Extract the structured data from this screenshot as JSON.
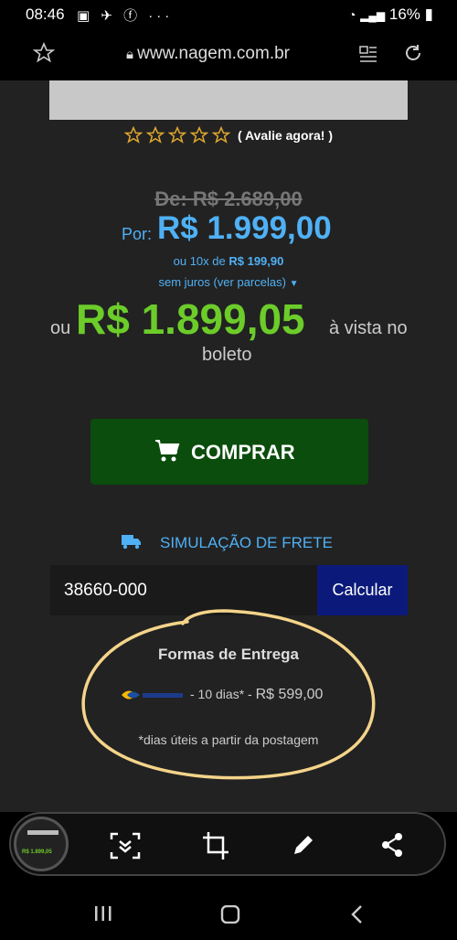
{
  "status_bar": {
    "time": "08:46",
    "battery": "16%"
  },
  "browser": {
    "url": "www.nagem.com.br"
  },
  "rating": {
    "label": "( Avalie agora! )"
  },
  "price": {
    "old": "De: R$ 2.689,00",
    "por_label": "Por:",
    "current": "R$ 1.999,00",
    "installments_prefix": "ou 10x de",
    "installments_value": "R$ 199,90",
    "installments_note": "sem juros (ver parcelas)",
    "ou": "ou",
    "boleto_price": "R$ 1.899,05",
    "boleto_suffix": "à vista no",
    "boleto_word": "boleto"
  },
  "buy_button": {
    "label": "COMPRAR"
  },
  "shipping": {
    "title": "SIMULAÇÃO DE FRETE",
    "cep_value": "38660-000",
    "calc_label": "Calcular",
    "delivery_title": "Formas de Entrega",
    "option_days": " - 10 dias* - ",
    "option_price": "R$ 599,00",
    "note": "*dias úteis a partir da postagem"
  },
  "toolbar": {
    "thumb_price": "R$ 1.899,05"
  },
  "colors": {
    "accent_blue": "#4fb1f5",
    "green_price": "#6ccc2a",
    "buy_green": "#0a4d0c",
    "calc_blue": "#0b1a7a",
    "circle_yellow": "#f4d48a"
  }
}
